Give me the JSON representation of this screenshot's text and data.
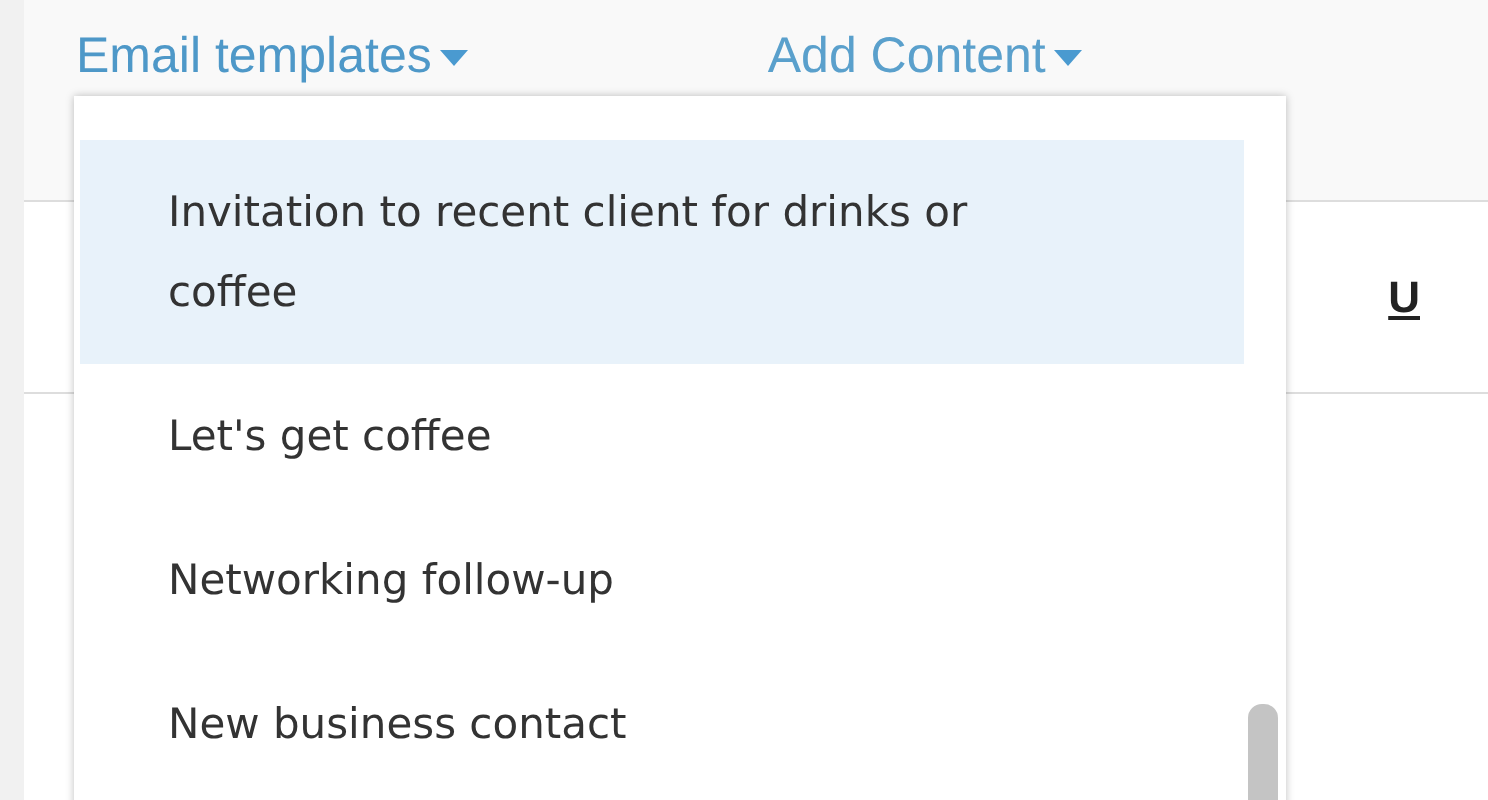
{
  "menus": [
    {
      "label": "Email templates",
      "expanded": true
    },
    {
      "label": "Add Content",
      "expanded": false
    }
  ],
  "toolbar": {
    "underline_button": "U"
  },
  "dropdown": {
    "items": [
      {
        "label": "Invitation to recent client for drinks or coffee",
        "selected": true
      },
      {
        "label": "Let's get coffee",
        "selected": false
      },
      {
        "label": "Networking follow-up",
        "selected": false
      },
      {
        "label": "New business contact",
        "selected": false
      }
    ]
  }
}
